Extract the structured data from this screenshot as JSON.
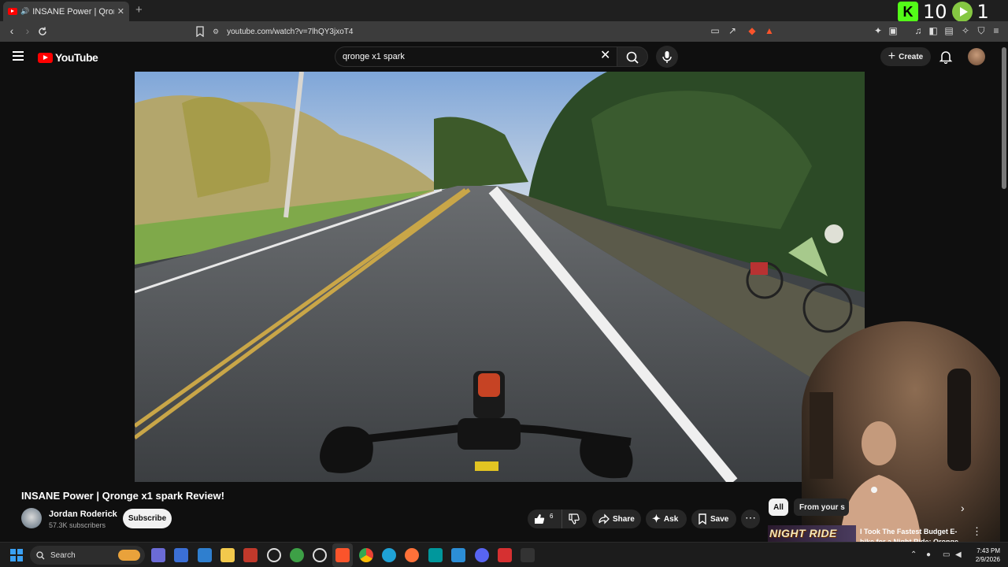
{
  "browser": {
    "tab_title": "INSANE Power | Qronge x1 spark",
    "tab_close": "✕",
    "new_tab": "+",
    "url": "youtube.com/watch?v=7lhQY3jxoT4"
  },
  "overlay": {
    "kick_letter": "K",
    "kick_count": "10",
    "rumble_count": "1"
  },
  "youtube": {
    "logo_text": "YouTube",
    "search_query": "qronge x1 spark",
    "create_label": "Create"
  },
  "video": {
    "title": "INSANE Power | Qronge x1 spark Review!",
    "channel_name": "Jordan Roderick",
    "subscribers": "57.3K subscribers",
    "subscribe_label": "Subscribe",
    "like_count": "6",
    "share_label": "Share",
    "ask_label": "Ask",
    "save_label": "Save"
  },
  "sidebar": {
    "chips": [
      "All",
      "From your s"
    ],
    "recommendation": {
      "thumb_text": "NIGHT RIDE",
      "title": "I Took The Fastest Budget E-bike for a Night Ride: Qronge"
    }
  },
  "taskbar": {
    "search_placeholder": "Search",
    "time": "7:43 PM",
    "date": "2/9/2026"
  },
  "colors": {
    "youtube_red": "#ff0000",
    "kick_green": "#53fc18",
    "rumble_green": "#85c742",
    "page_bg": "#0f0f0f"
  }
}
